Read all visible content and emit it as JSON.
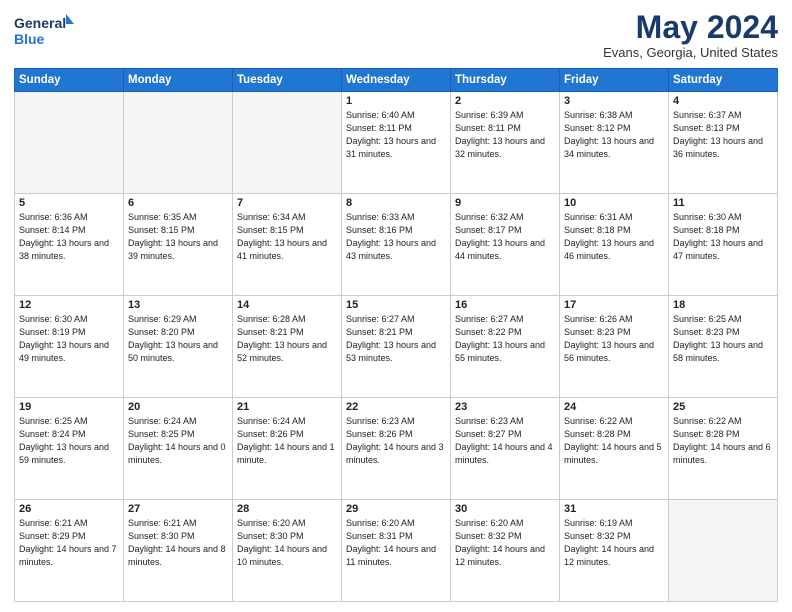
{
  "header": {
    "logo_line1": "General",
    "logo_line2": "Blue",
    "month_title": "May 2024",
    "location": "Evans, Georgia, United States"
  },
  "days_of_week": [
    "Sunday",
    "Monday",
    "Tuesday",
    "Wednesday",
    "Thursday",
    "Friday",
    "Saturday"
  ],
  "weeks": [
    [
      {
        "day": "",
        "info": ""
      },
      {
        "day": "",
        "info": ""
      },
      {
        "day": "",
        "info": ""
      },
      {
        "day": "1",
        "info": "Sunrise: 6:40 AM\nSunset: 8:11 PM\nDaylight: 13 hours\nand 31 minutes."
      },
      {
        "day": "2",
        "info": "Sunrise: 6:39 AM\nSunset: 8:11 PM\nDaylight: 13 hours\nand 32 minutes."
      },
      {
        "day": "3",
        "info": "Sunrise: 6:38 AM\nSunset: 8:12 PM\nDaylight: 13 hours\nand 34 minutes."
      },
      {
        "day": "4",
        "info": "Sunrise: 6:37 AM\nSunset: 8:13 PM\nDaylight: 13 hours\nand 36 minutes."
      }
    ],
    [
      {
        "day": "5",
        "info": "Sunrise: 6:36 AM\nSunset: 8:14 PM\nDaylight: 13 hours\nand 38 minutes."
      },
      {
        "day": "6",
        "info": "Sunrise: 6:35 AM\nSunset: 8:15 PM\nDaylight: 13 hours\nand 39 minutes."
      },
      {
        "day": "7",
        "info": "Sunrise: 6:34 AM\nSunset: 8:15 PM\nDaylight: 13 hours\nand 41 minutes."
      },
      {
        "day": "8",
        "info": "Sunrise: 6:33 AM\nSunset: 8:16 PM\nDaylight: 13 hours\nand 43 minutes."
      },
      {
        "day": "9",
        "info": "Sunrise: 6:32 AM\nSunset: 8:17 PM\nDaylight: 13 hours\nand 44 minutes."
      },
      {
        "day": "10",
        "info": "Sunrise: 6:31 AM\nSunset: 8:18 PM\nDaylight: 13 hours\nand 46 minutes."
      },
      {
        "day": "11",
        "info": "Sunrise: 6:30 AM\nSunset: 8:18 PM\nDaylight: 13 hours\nand 47 minutes."
      }
    ],
    [
      {
        "day": "12",
        "info": "Sunrise: 6:30 AM\nSunset: 8:19 PM\nDaylight: 13 hours\nand 49 minutes."
      },
      {
        "day": "13",
        "info": "Sunrise: 6:29 AM\nSunset: 8:20 PM\nDaylight: 13 hours\nand 50 minutes."
      },
      {
        "day": "14",
        "info": "Sunrise: 6:28 AM\nSunset: 8:21 PM\nDaylight: 13 hours\nand 52 minutes."
      },
      {
        "day": "15",
        "info": "Sunrise: 6:27 AM\nSunset: 8:21 PM\nDaylight: 13 hours\nand 53 minutes."
      },
      {
        "day": "16",
        "info": "Sunrise: 6:27 AM\nSunset: 8:22 PM\nDaylight: 13 hours\nand 55 minutes."
      },
      {
        "day": "17",
        "info": "Sunrise: 6:26 AM\nSunset: 8:23 PM\nDaylight: 13 hours\nand 56 minutes."
      },
      {
        "day": "18",
        "info": "Sunrise: 6:25 AM\nSunset: 8:23 PM\nDaylight: 13 hours\nand 58 minutes."
      }
    ],
    [
      {
        "day": "19",
        "info": "Sunrise: 6:25 AM\nSunset: 8:24 PM\nDaylight: 13 hours\nand 59 minutes."
      },
      {
        "day": "20",
        "info": "Sunrise: 6:24 AM\nSunset: 8:25 PM\nDaylight: 14 hours\nand 0 minutes."
      },
      {
        "day": "21",
        "info": "Sunrise: 6:24 AM\nSunset: 8:26 PM\nDaylight: 14 hours\nand 1 minute."
      },
      {
        "day": "22",
        "info": "Sunrise: 6:23 AM\nSunset: 8:26 PM\nDaylight: 14 hours\nand 3 minutes."
      },
      {
        "day": "23",
        "info": "Sunrise: 6:23 AM\nSunset: 8:27 PM\nDaylight: 14 hours\nand 4 minutes."
      },
      {
        "day": "24",
        "info": "Sunrise: 6:22 AM\nSunset: 8:28 PM\nDaylight: 14 hours\nand 5 minutes."
      },
      {
        "day": "25",
        "info": "Sunrise: 6:22 AM\nSunset: 8:28 PM\nDaylight: 14 hours\nand 6 minutes."
      }
    ],
    [
      {
        "day": "26",
        "info": "Sunrise: 6:21 AM\nSunset: 8:29 PM\nDaylight: 14 hours\nand 7 minutes."
      },
      {
        "day": "27",
        "info": "Sunrise: 6:21 AM\nSunset: 8:30 PM\nDaylight: 14 hours\nand 8 minutes."
      },
      {
        "day": "28",
        "info": "Sunrise: 6:20 AM\nSunset: 8:30 PM\nDaylight: 14 hours\nand 10 minutes."
      },
      {
        "day": "29",
        "info": "Sunrise: 6:20 AM\nSunset: 8:31 PM\nDaylight: 14 hours\nand 11 minutes."
      },
      {
        "day": "30",
        "info": "Sunrise: 6:20 AM\nSunset: 8:32 PM\nDaylight: 14 hours\nand 12 minutes."
      },
      {
        "day": "31",
        "info": "Sunrise: 6:19 AM\nSunset: 8:32 PM\nDaylight: 14 hours\nand 12 minutes."
      },
      {
        "day": "",
        "info": ""
      }
    ]
  ]
}
